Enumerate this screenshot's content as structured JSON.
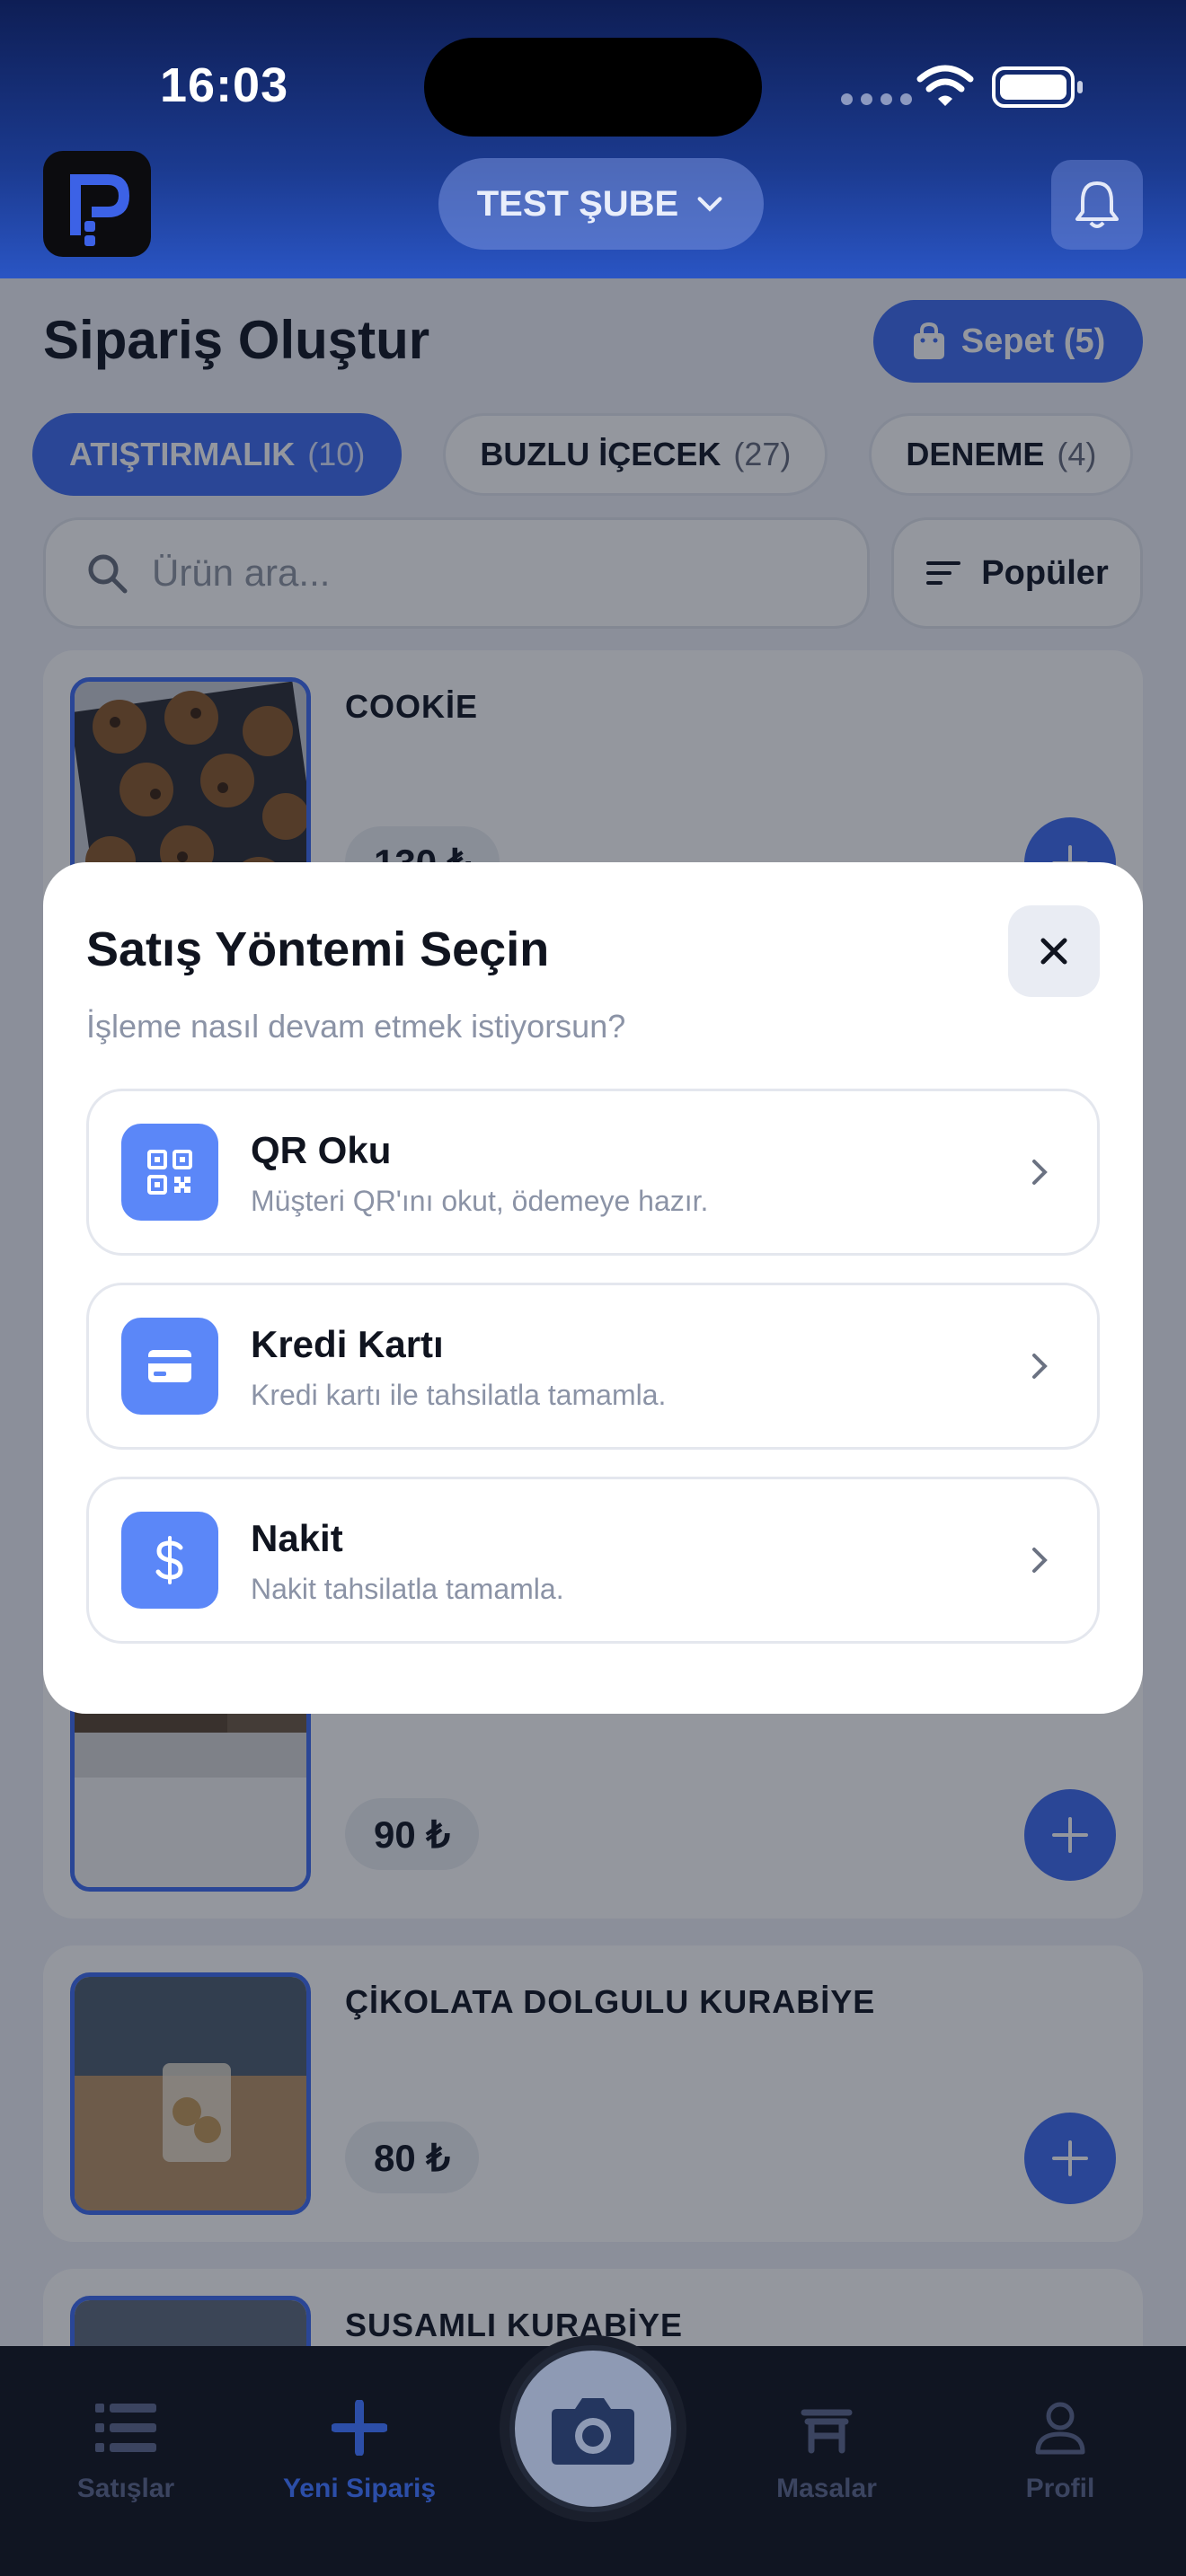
{
  "status_bar": {
    "time": "16:03"
  },
  "header": {
    "branch": "TEST ŞUBE"
  },
  "page": {
    "title": "Sipariş Oluştur",
    "cart_label": "Sepet (5)",
    "categories": [
      {
        "label": "ATIŞTIRMALIK",
        "count": "(10)"
      },
      {
        "label": "BUZLU İÇECEK",
        "count": "(27)"
      },
      {
        "label": "DENEME",
        "count": "(4)"
      }
    ],
    "search_placeholder": "Ürün ara...",
    "sort_label": "Popüler"
  },
  "products": [
    {
      "name": "COOKİE",
      "price": "130 ₺"
    },
    {
      "name": "",
      "price": "90 ₺"
    },
    {
      "name": "ÇİKOLATA DOLGULU KURABİYE",
      "price": "80 ₺"
    },
    {
      "name": "SUSAMLI KURABİYE",
      "price": ""
    }
  ],
  "modal": {
    "title": "Satış Yöntemi Seçin",
    "subtitle": "İşleme nasıl devam etmek istiyorsun?",
    "options": [
      {
        "label": "QR Oku",
        "desc": "Müşteri QR'ını okut, ödemeye hazır.",
        "icon": "qr-code-icon"
      },
      {
        "label": "Kredi Kartı",
        "desc": "Kredi kartı ile tahsilatla tamamla.",
        "icon": "credit-card-icon"
      },
      {
        "label": "Nakit",
        "desc": "Nakit tahsilatla tamamla.",
        "icon": "dollar-icon"
      }
    ]
  },
  "tabbar": {
    "items": [
      {
        "label": "Satışlar"
      },
      {
        "label": "Yeni Sipariş"
      },
      {
        "label": "Masalar"
      },
      {
        "label": "Profil"
      }
    ]
  },
  "colors": {
    "accent": "#3e6cf0",
    "header": "#1b3a8f",
    "icon_bg": "#5b87f8"
  }
}
